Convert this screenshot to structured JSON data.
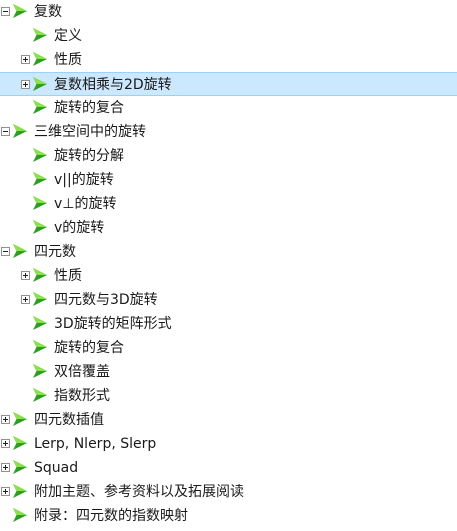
{
  "outline": {
    "items": [
      {
        "label": "复数",
        "expander": "expanded"
      },
      {
        "label": "定义",
        "expander": "none"
      },
      {
        "label": "性质",
        "expander": "collapsed"
      },
      {
        "label": "复数相乘与2D旋转",
        "expander": "collapsed",
        "selected": true
      },
      {
        "label": "旋转的复合",
        "expander": "none"
      },
      {
        "label": "三维空间中的旋转",
        "expander": "expanded"
      },
      {
        "label": "旋转的分解",
        "expander": "none"
      },
      {
        "label": "v||的旋转",
        "expander": "none"
      },
      {
        "label": "v⊥的旋转",
        "expander": "none"
      },
      {
        "label": "v的旋转",
        "expander": "none"
      },
      {
        "label": "四元数",
        "expander": "expanded"
      },
      {
        "label": "性质",
        "expander": "collapsed"
      },
      {
        "label": "四元数与3D旋转",
        "expander": "collapsed"
      },
      {
        "label": "3D旋转的矩阵形式",
        "expander": "none"
      },
      {
        "label": "旋转的复合",
        "expander": "none"
      },
      {
        "label": "双倍覆盖",
        "expander": "none"
      },
      {
        "label": "指数形式",
        "expander": "none"
      },
      {
        "label": "四元数插值",
        "expander": "collapsed"
      },
      {
        "label": "Lerp, Nlerp, Slerp",
        "expander": "collapsed"
      },
      {
        "label": "Squad",
        "expander": "collapsed"
      },
      {
        "label": "附加主题、参考资料以及拓展阅读",
        "expander": "collapsed"
      },
      {
        "label": "附录：四元数的指数映射",
        "expander": "none"
      }
    ]
  },
  "icon": "bookmark-icon",
  "colors": {
    "bookmark_light": "#8ee04a",
    "bookmark_dark": "#2e9e1e",
    "selection_fill": "#cce8ff",
    "selection_border": "#99d1ff"
  }
}
